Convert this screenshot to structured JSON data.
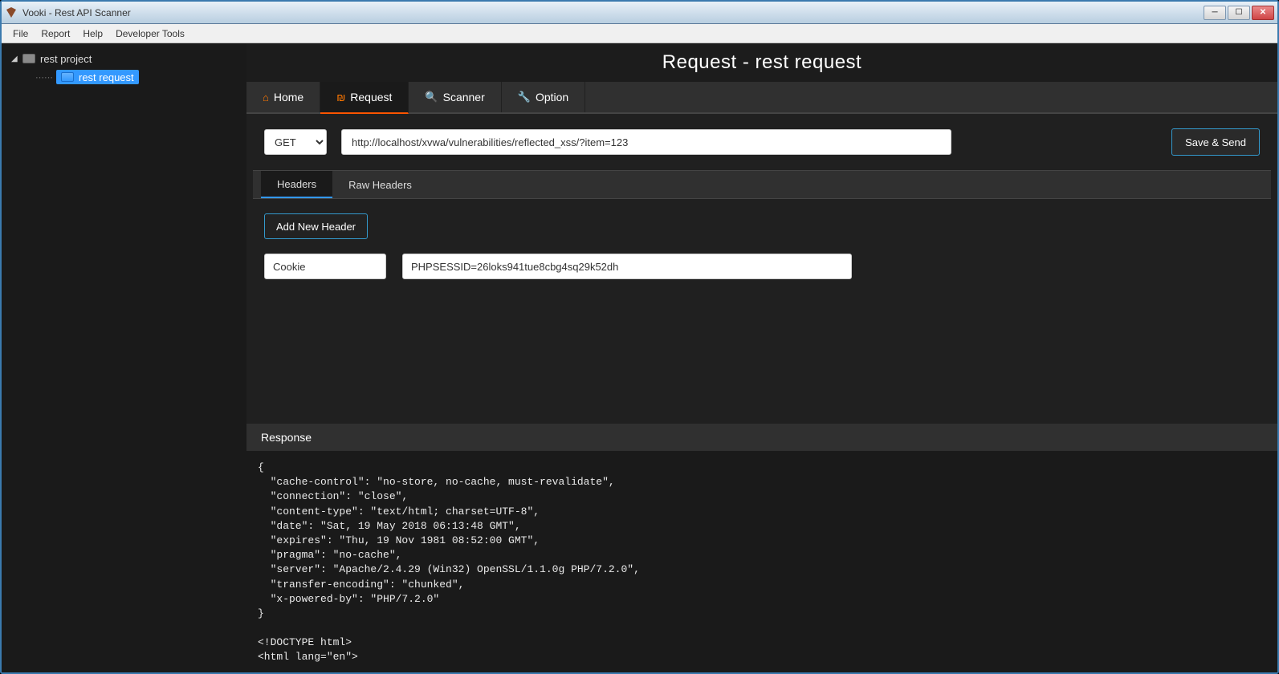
{
  "titlebar": {
    "title": "Vooki - Rest API Scanner"
  },
  "menubar": {
    "items": [
      "File",
      "Report",
      "Help",
      "Developer Tools"
    ]
  },
  "sidebar": {
    "project": "rest project",
    "request": "rest request"
  },
  "page": {
    "title": "Request - rest request"
  },
  "tabs": {
    "home": "Home",
    "request": "Request",
    "scanner": "Scanner",
    "option": "Option"
  },
  "requestRow": {
    "method": "GET",
    "url": "http://localhost/xvwa/vulnerabilities/reflected_xss/?item=123",
    "save": "Save & Send"
  },
  "subtabs": {
    "headers": "Headers",
    "raw": "Raw Headers"
  },
  "headersPanel": {
    "addButton": "Add New Header",
    "rows": [
      {
        "key": "Cookie",
        "value": "PHPSESSID=26loks941tue8cbg4sq29k52dh"
      }
    ]
  },
  "response": {
    "label": "Response",
    "body": "{\n  \"cache-control\": \"no-store, no-cache, must-revalidate\",\n  \"connection\": \"close\",\n  \"content-type\": \"text/html; charset=UTF-8\",\n  \"date\": \"Sat, 19 May 2018 06:13:48 GMT\",\n  \"expires\": \"Thu, 19 Nov 1981 08:52:00 GMT\",\n  \"pragma\": \"no-cache\",\n  \"server\": \"Apache/2.4.29 (Win32) OpenSSL/1.1.0g PHP/7.2.0\",\n  \"transfer-encoding\": \"chunked\",\n  \"x-powered-by\": \"PHP/7.2.0\"\n}\n\n<!DOCTYPE html>\n<html lang=\"en\">"
  }
}
